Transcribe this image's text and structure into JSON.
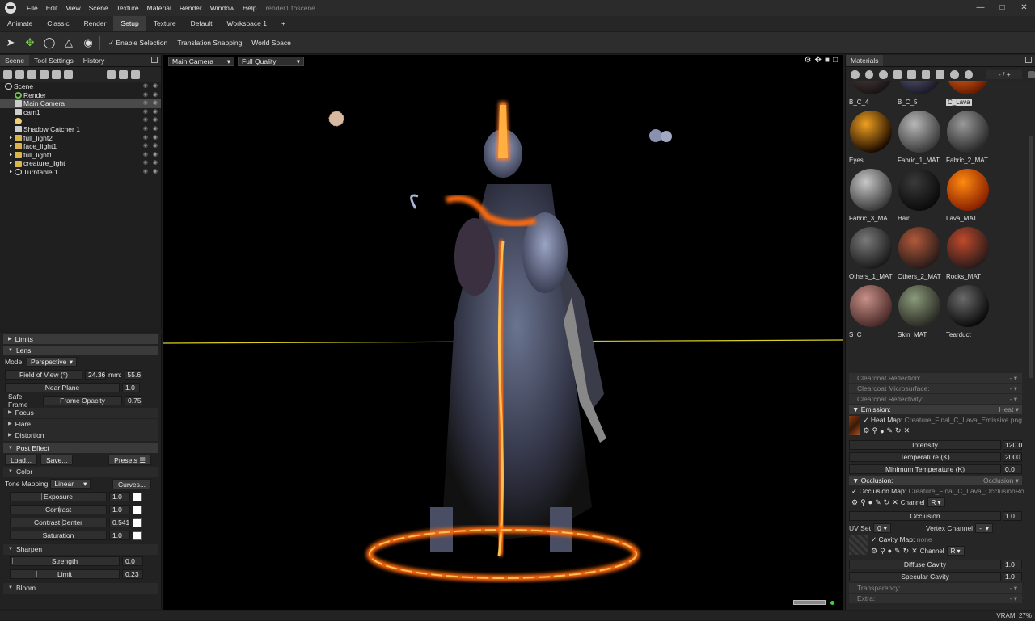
{
  "app": {
    "document": "render1.tbscene"
  },
  "menu": [
    "File",
    "Edit",
    "View",
    "Scene",
    "Texture",
    "Material",
    "Render",
    "Window",
    "Help"
  ],
  "tabs": [
    "Animate",
    "Classic",
    "Render",
    "Setup",
    "Texture",
    "Default",
    "Workspace 1",
    "+"
  ],
  "active_tab": "Setup",
  "toolbar": {
    "enable_selection": "Enable Selection",
    "translation_snapping": "Translation Snapping",
    "world_space": "World Space"
  },
  "scene_panel": {
    "tabs": [
      "Scene",
      "Tool Settings",
      "History"
    ],
    "tree": [
      {
        "label": "Scene",
        "icon": "scene-icon"
      },
      {
        "label": "Render",
        "icon": "gear-icon"
      },
      {
        "label": "Main Camera",
        "icon": "camera-icon",
        "selected": true
      },
      {
        "label": "cam1",
        "icon": "camera-icon"
      },
      {
        "label": "",
        "icon": "sky-icon"
      },
      {
        "label": "Shadow Catcher 1",
        "icon": "shadow-catcher-icon"
      },
      {
        "label": "full_light2",
        "icon": "folder-icon"
      },
      {
        "label": "face_light1",
        "icon": "folder-icon"
      },
      {
        "label": "full_light1",
        "icon": "folder-icon"
      },
      {
        "label": "creature_light",
        "icon": "folder-icon"
      },
      {
        "label": "Turntable 1",
        "icon": "turntable-icon"
      }
    ]
  },
  "camera_props": {
    "limits": "Limits",
    "lens": "Lens",
    "mode_label": "Mode",
    "mode_value": "Perspective",
    "fov_label": "Field of View (°)",
    "fov_value": "24.36",
    "mm_label": "mm:",
    "mm_value": "55.6",
    "near_plane_label": "Near Plane",
    "near_plane_value": "1.0",
    "safe_frame_label": "Safe Frame",
    "frame_opacity_label": "Frame Opacity",
    "frame_opacity_value": "0.75",
    "focus": "Focus",
    "flare": "Flare",
    "distortion": "Distortion",
    "post_effect": "Post Effect",
    "load": "Load...",
    "save": "Save...",
    "presets": "Presets",
    "color": "Color",
    "tone_mapping_label": "Tone Mapping",
    "tone_mapping_value": "Linear",
    "curves": "Curves...",
    "exposure_label": "Exposure",
    "exposure_value": "1.0",
    "contrast_label": "Contrast",
    "contrast_value": "1.0",
    "contrast_center_label": "Contrast Center",
    "contrast_center_value": "0.541",
    "saturation_label": "Saturation",
    "saturation_value": "1.0",
    "sharpen": "Sharpen",
    "strength_label": "Strength",
    "strength_value": "0.0",
    "limit_label": "Limit",
    "limit_value": "0.23",
    "bloom": "Bloom"
  },
  "viewport": {
    "camera": "Main Camera",
    "quality": "Full Quality"
  },
  "materials_panel": {
    "title": "Materials",
    "counter": "- / +",
    "items": [
      {
        "label": "B_C_4",
        "colors": [
          "#5a4a48",
          "#1a1414"
        ]
      },
      {
        "label": "B_C_5",
        "colors": [
          "#6a6a90",
          "#1a1a28"
        ]
      },
      {
        "label": "C_Lava",
        "colors": [
          "#ff7a20",
          "#6a1a00"
        ],
        "selected": true
      },
      {
        "label": "Eyes",
        "colors": [
          "#f0a020",
          "#1a0a00"
        ]
      },
      {
        "label": "Fabric_1_MAT",
        "colors": [
          "#b8b8b8",
          "#3a3a3a"
        ]
      },
      {
        "label": "Fabric_2_MAT",
        "colors": [
          "#9a9a9a",
          "#2a2a2a"
        ]
      },
      {
        "label": "Fabric_3_MAT",
        "colors": [
          "#c8c8c8",
          "#3a3a3a"
        ]
      },
      {
        "label": "Hair",
        "colors": [
          "#3a3a3a",
          "#0a0a0a"
        ]
      },
      {
        "label": "Lava_MAT",
        "colors": [
          "#ff8a10",
          "#8a2000"
        ]
      },
      {
        "label": "Others_1_MAT",
        "colors": [
          "#7a7a7a",
          "#1a1a1a"
        ]
      },
      {
        "label": "Others_2_MAT",
        "colors": [
          "#b05a3a",
          "#2a1a18"
        ]
      },
      {
        "label": "Rocks_MAT",
        "colors": [
          "#c04a2a",
          "#2a1a1a"
        ]
      },
      {
        "label": "S_C",
        "colors": [
          "#c89088",
          "#4a2a28"
        ]
      },
      {
        "label": "Skin_MAT",
        "colors": [
          "#8a9a7a",
          "#2a2a24"
        ]
      },
      {
        "label": "Tearduct",
        "colors": [
          "#6a6a6a",
          "#0a0a0a"
        ]
      }
    ]
  },
  "material_props": {
    "clearcoat_reflection": "Clearcoat Reflection:",
    "clearcoat_microsurface": "Clearcoat Microsurface:",
    "clearcoat_reflectivity": "Clearcoat Reflectivity:",
    "emission": "Emission:",
    "emission_type": "Heat",
    "heat_map_label": "Heat Map:",
    "heat_map_file": "Creature_Final_C_Lava_Emissive.png",
    "intensity_label": "Intensity",
    "intensity_value": "120.0",
    "temperature_label": "Temperature (K)",
    "temperature_value": "2000.",
    "min_temperature_label": "Minimum Temperature (K)",
    "min_temperature_value": "0.0",
    "occlusion": "Occlusion:",
    "occlusion_type": "Occlusion",
    "occlusion_map_label": "Occlusion Map:",
    "occlusion_map_file": "Creature_Final_C_Lava_OcclusionRo",
    "channel_label": "Channel",
    "channel_value": "R",
    "occlusion_label": "Occlusion",
    "occlusion_value": "1.0",
    "uv_set_label": "UV Set",
    "uv_set_value": "0",
    "vertex_channel_label": "Vertex Channel",
    "vertex_channel_value": "-",
    "cavity_map_label": "Cavity Map:",
    "cavity_map_file": "none",
    "cavity_channel_value": "R",
    "diffuse_cavity_label": "Diffuse Cavity",
    "diffuse_cavity_value": "1.0",
    "specular_cavity_label": "Specular Cavity",
    "specular_cavity_value": "1.0",
    "transparency": "Transparency:",
    "extra": "Extra:"
  },
  "status": {
    "vram": "VRAM: 27%"
  }
}
